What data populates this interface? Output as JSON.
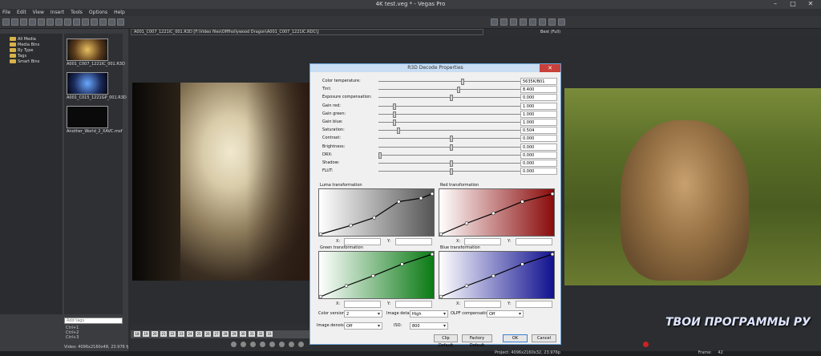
{
  "window": {
    "title": "4K test.veg * - Vegas Pro"
  },
  "menu": [
    "File",
    "Edit",
    "View",
    "Insert",
    "Tools",
    "Options",
    "Help"
  ],
  "explorer": {
    "tree": [
      "All Media",
      "Media Bins",
      "By Type",
      "Tags",
      "Smart Bins"
    ],
    "media": [
      {
        "name": "A001_C007_1221IC_001.R3D"
      },
      {
        "name": "A001_C015_1221GP_001.R3D"
      },
      {
        "name": "Another_World_2_XAVC.mxf"
      }
    ],
    "search_placeholder": "Add tags",
    "shortcuts": [
      "Ctrl+1",
      "Ctrl+2",
      "Ctrl+3"
    ],
    "video_info": "Video: 4096x2160x48, 23.976 fps, 0:..."
  },
  "preview": {
    "path": "A001_C007_1221IC_001.R3D   [F:\\Video files\\Offfhollywood Dragon\\A001_C007_1221IC.RDC\\]",
    "zoom": "Best (Full)"
  },
  "dialog": {
    "title": "R3D Decode Properties",
    "params": [
      {
        "label": "Color temperature:",
        "value": "5635K/B01",
        "pos": 0.58
      },
      {
        "label": "Tint:",
        "value": "8.400",
        "pos": 0.55
      },
      {
        "label": "Exposure compensation:",
        "value": "0.000",
        "pos": 0.5
      },
      {
        "label": "Gain red:",
        "value": "1.000",
        "pos": 0.1
      },
      {
        "label": "Gain green:",
        "value": "1.000",
        "pos": 0.1
      },
      {
        "label": "Gain blue:",
        "value": "1.000",
        "pos": 0.1
      },
      {
        "label": "Saturation:",
        "value": "0.504",
        "pos": 0.13
      },
      {
        "label": "Contrast:",
        "value": "0.000",
        "pos": 0.5
      },
      {
        "label": "Brightness:",
        "value": "0.000",
        "pos": 0.5
      },
      {
        "label": "DRX:",
        "value": "0.000",
        "pos": 0.0
      },
      {
        "label": "Shadow:",
        "value": "0.000",
        "pos": 0.5
      },
      {
        "label": "FLUT:",
        "value": "0.000",
        "pos": 0.5
      }
    ],
    "curves": [
      {
        "title": "Luma transformation",
        "from": "#ffffff",
        "to": "#555555",
        "pts": [
          [
            0,
            0
          ],
          [
            0.27,
            0.2
          ],
          [
            0.48,
            0.38
          ],
          [
            0.7,
            0.75
          ],
          [
            0.9,
            0.83
          ],
          [
            1,
            0.93
          ]
        ]
      },
      {
        "title": "Red transformation",
        "from": "#ffffff",
        "to": "#8a0a0a",
        "pts": [
          [
            0,
            0
          ],
          [
            0.23,
            0.25
          ],
          [
            0.47,
            0.48
          ],
          [
            0.73,
            0.75
          ],
          [
            1,
            0.93
          ]
        ]
      },
      {
        "title": "Green transformation",
        "from": "#ffffff",
        "to": "#0a7a14",
        "pts": [
          [
            0,
            0
          ],
          [
            0.23,
            0.25
          ],
          [
            0.47,
            0.48
          ],
          [
            0.73,
            0.75
          ],
          [
            1,
            0.98
          ]
        ]
      },
      {
        "title": "Blue transformation",
        "from": "#ffffff",
        "to": "#101090",
        "pts": [
          [
            0,
            0
          ],
          [
            0.23,
            0.25
          ],
          [
            0.47,
            0.48
          ],
          [
            0.73,
            0.75
          ],
          [
            1,
            0.98
          ]
        ]
      }
    ],
    "x_label": "X:",
    "y_label": "Y:",
    "color_version_label": "Color version:",
    "color_version": "2",
    "image_detail_label": "Image detail:",
    "image_detail": "High",
    "olpf_label": "OLPF compensation:",
    "olpf": "Off",
    "image_denoise_label": "Image denoise:",
    "image_denoise": "Off",
    "iso_label": "ISO:",
    "iso": "800",
    "buttons": {
      "clip_default": "Clip Default",
      "factory_default": "Factory Default",
      "ok": "OK",
      "cancel": "Cancel"
    }
  },
  "timeline": {
    "markers": [
      "18",
      "19",
      "20",
      "21",
      "22",
      "23",
      "24",
      "25",
      "26",
      "27",
      "28",
      "29",
      "30",
      "31",
      "32",
      "33"
    ]
  },
  "status": {
    "project": "Project:   4096x2160x32, 23.976p",
    "frame_label": "Frame:",
    "frame": "42"
  },
  "watermark": "ТВОИ ПРОГРАММЫ РУ"
}
